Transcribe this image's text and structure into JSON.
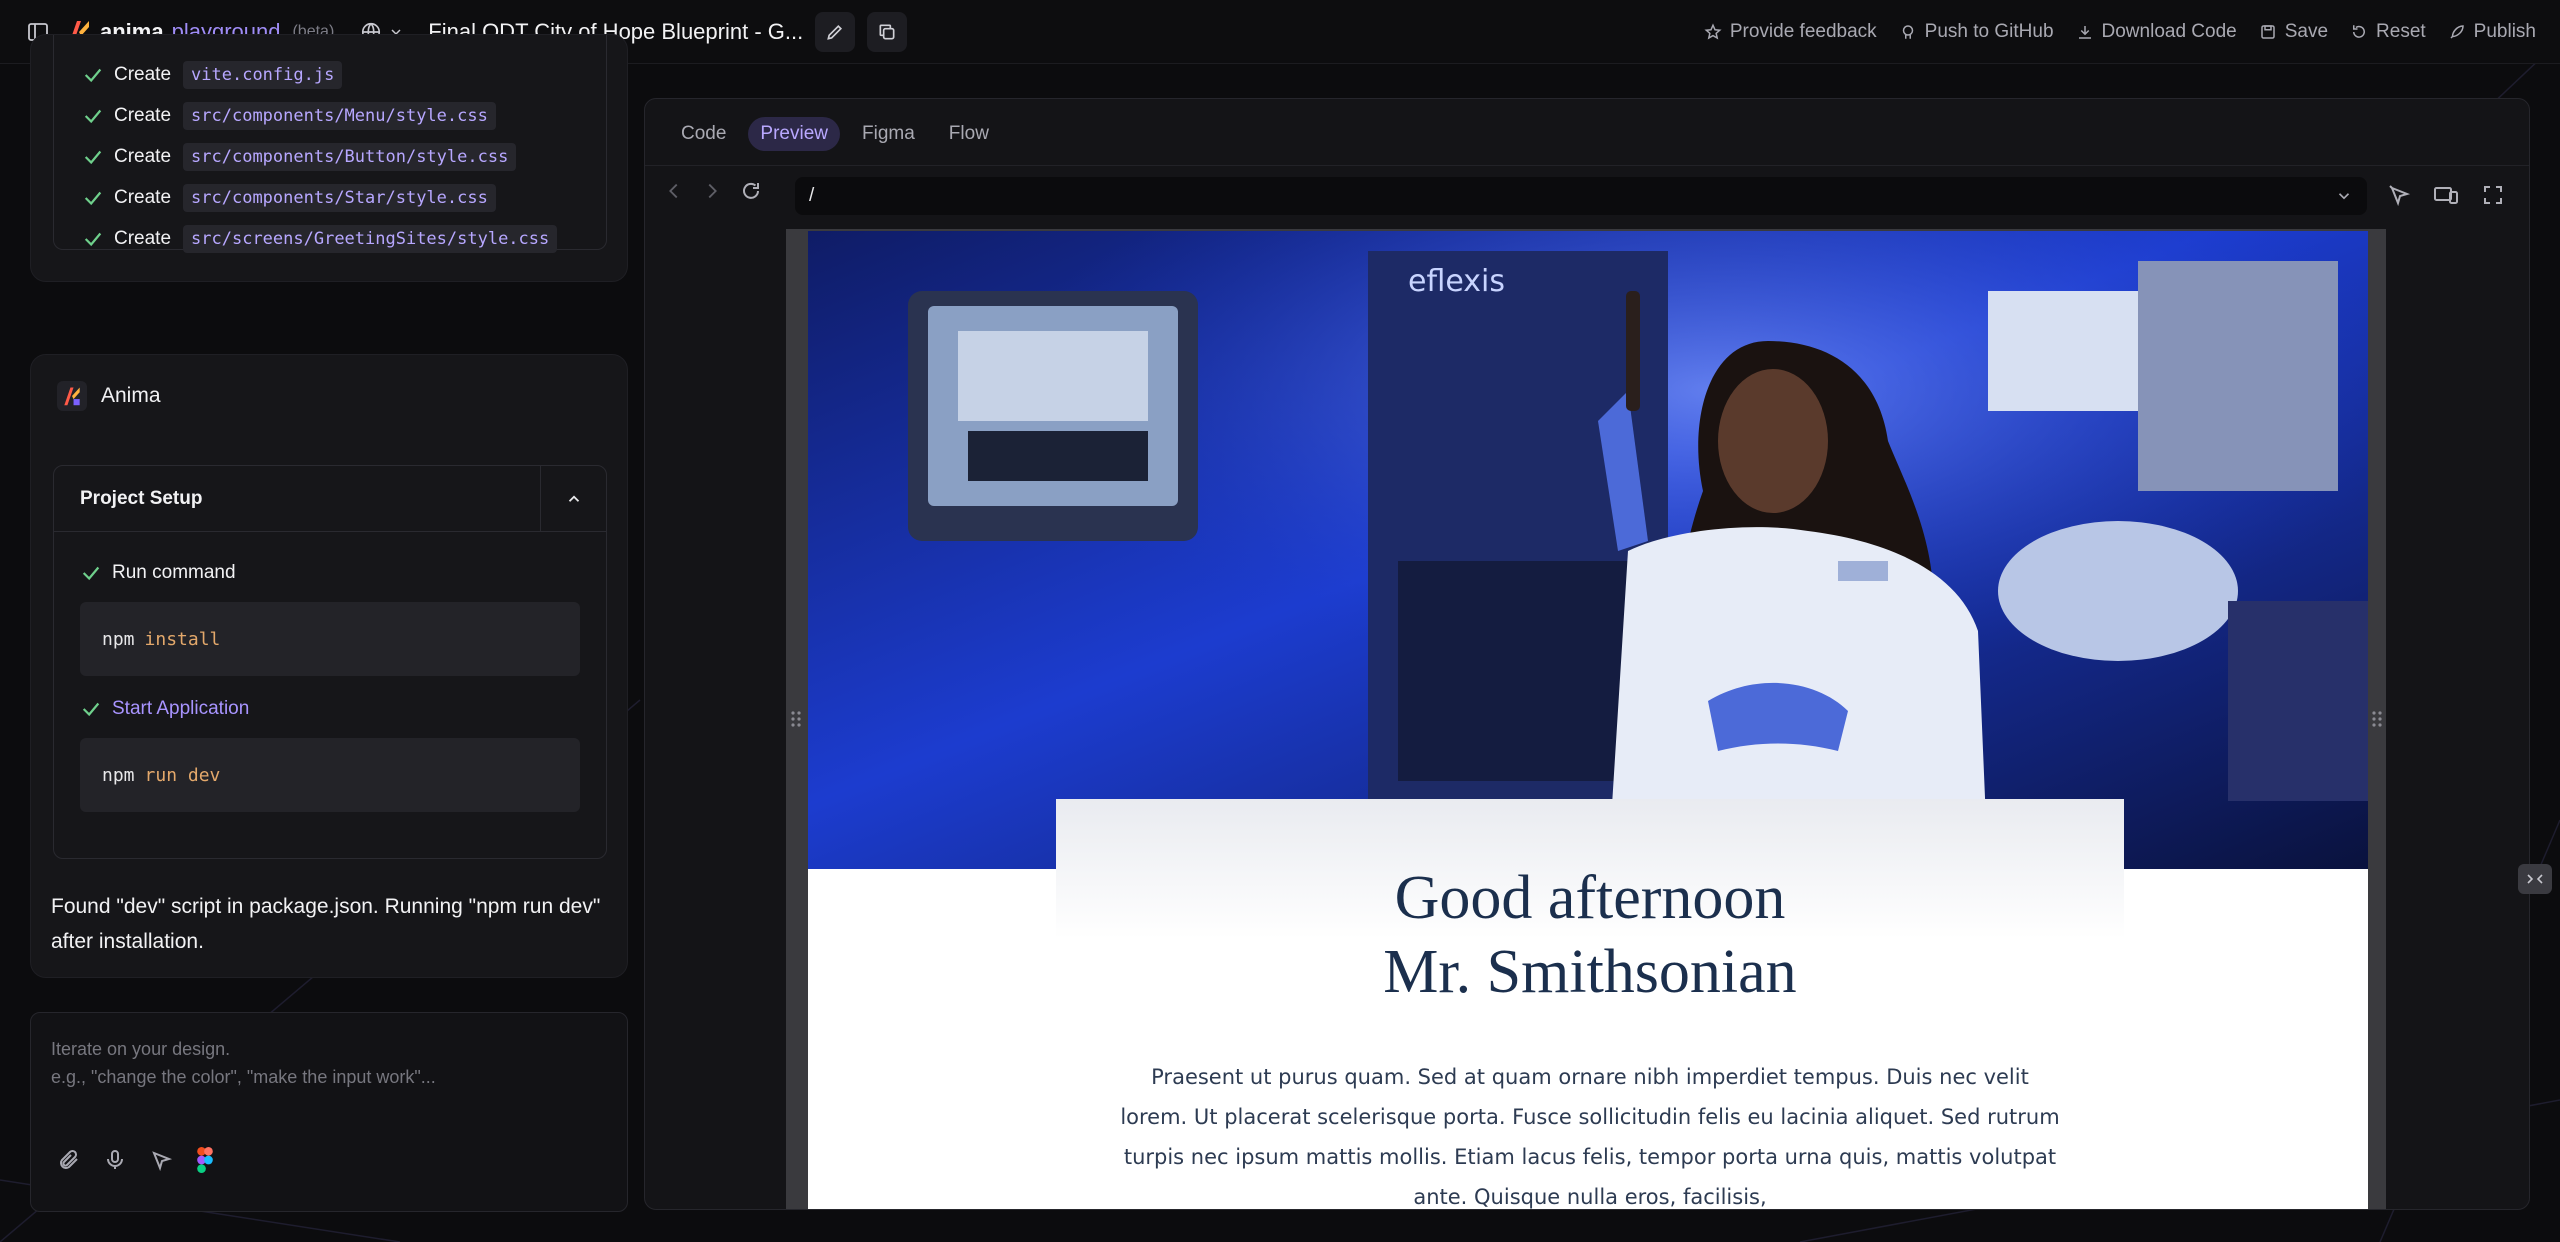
{
  "app": {
    "logo_name": "anima",
    "logo_product": "playground",
    "logo_beta": "(beta)",
    "project_title": "Final ODT City of Hope Blueprint - G..."
  },
  "toolbar": {
    "feedback": "Provide feedback",
    "github": "Push to GitHub",
    "download": "Download Code",
    "save": "Save",
    "reset": "Reset",
    "publish": "Publish"
  },
  "files": [
    {
      "action": "Create",
      "path": "vite.config.js"
    },
    {
      "action": "Create",
      "path": "src/components/Menu/style.css"
    },
    {
      "action": "Create",
      "path": "src/components/Button/style.css"
    },
    {
      "action": "Create",
      "path": "src/components/Star/style.css"
    },
    {
      "action": "Create",
      "path": "src/screens/GreetingSites/style.css"
    }
  ],
  "anima": {
    "name": "Anima",
    "setup_title": "Project Setup",
    "step1_label": "Run command",
    "step1_bin": "npm",
    "step1_arg": "install",
    "step2_label": "Start Application",
    "step2_bin": "npm",
    "step2_arg": "run dev",
    "found_text": "Found \"dev\" script in package.json. Running \"npm run dev\" after installation."
  },
  "prompt": {
    "line1": "Iterate on your design.",
    "line2": "e.g., \"change the color\", \"make the input work\"..."
  },
  "preview": {
    "tabs": [
      "Code",
      "Preview",
      "Figma",
      "Flow"
    ],
    "active_tab": "Preview",
    "url": "/"
  },
  "site": {
    "greeting_line1": "Good afternoon",
    "greeting_line2": "Mr. Smithsonian",
    "body": "Praesent ut purus quam. Sed at quam ornare nibh imperdiet tempus. Duis nec velit lorem. Ut placerat scelerisque porta. Fusce sollicitudin felis eu lacinia aliquet. Sed rutrum turpis nec ipsum mattis mollis. Etiam lacus felis, tempor porta urna quis, mattis volutpat ante. Quisque nulla eros, facilisis,",
    "hero_device_brand": "eflexis"
  },
  "colors": {
    "accent": "#a894ff",
    "background": "#0c0c0e",
    "check": "#6fd08c",
    "heading_navy": "#1b2f4d"
  }
}
